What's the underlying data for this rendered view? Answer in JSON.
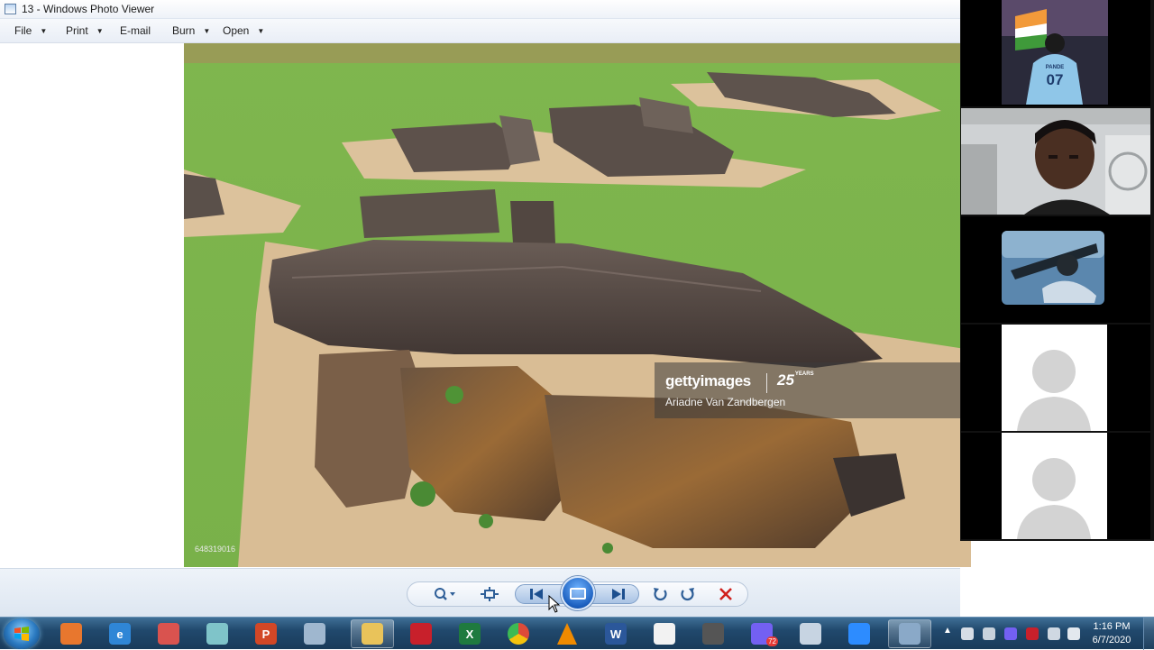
{
  "window": {
    "title": "13 - Windows Photo Viewer",
    "icon": "photo-viewer-icon"
  },
  "menu": [
    {
      "label": "File",
      "has_dropdown": true
    },
    {
      "label": "Print",
      "has_dropdown": true
    },
    {
      "label": "E-mail",
      "has_dropdown": false
    },
    {
      "label": "Burn",
      "has_dropdown": true
    },
    {
      "label": "Open",
      "has_dropdown": true
    }
  ],
  "photo": {
    "watermark_brand": "gettyimages",
    "watermark_years": "25",
    "watermark_years_suffix": "YEARS",
    "watermark_credit": "Ariadne Van Zandbergen",
    "photo_id": "648319016"
  },
  "controls": [
    {
      "name": "zoom-icon",
      "label": "Change display size"
    },
    {
      "name": "actual-size-icon",
      "label": "Actual size"
    },
    {
      "name": "previous-icon",
      "label": "Previous"
    },
    {
      "name": "slideshow-icon",
      "label": "Play slide show"
    },
    {
      "name": "next-icon",
      "label": "Next"
    },
    {
      "name": "rotate-ccw-icon",
      "label": "Rotate counterclockwise"
    },
    {
      "name": "rotate-cw-icon",
      "label": "Rotate clockwise"
    },
    {
      "name": "delete-icon",
      "label": "Delete"
    }
  ],
  "video_panel": {
    "tiles": [
      {
        "kind": "image",
        "jersey_name": "PANDE",
        "jersey_number": "07"
      },
      {
        "kind": "camera"
      },
      {
        "kind": "image"
      },
      {
        "kind": "avatar"
      },
      {
        "kind": "avatar"
      }
    ]
  },
  "taskbar": {
    "apps": [
      {
        "name": "windows-media-player-icon",
        "color": "#e8772e",
        "glyph": ""
      },
      {
        "name": "internet-explorer-icon",
        "color": "#2f86d6",
        "glyph": "e"
      },
      {
        "name": "snipping-tool-icon",
        "color": "#d9534f",
        "glyph": ""
      },
      {
        "name": "notepad-icon",
        "color": "#7fc4c9",
        "glyph": ""
      },
      {
        "name": "powerpoint-icon",
        "color": "#d24726",
        "glyph": "P"
      },
      {
        "name": "calculator-icon",
        "color": "#9fb7cf",
        "glyph": ""
      },
      {
        "name": "file-explorer-icon",
        "color": "#e9c35a",
        "glyph": ""
      },
      {
        "name": "download-manager-icon",
        "color": "#c8202b",
        "glyph": ""
      },
      {
        "name": "excel-icon",
        "color": "#1f7a3f",
        "glyph": "X"
      },
      {
        "name": "chrome-icon",
        "color": "#dd4b39",
        "glyph": ""
      },
      {
        "name": "vlc-icon",
        "color": "#f08a00",
        "glyph": ""
      },
      {
        "name": "word-icon",
        "color": "#2b579a",
        "glyph": "W"
      },
      {
        "name": "sticky-notes-icon",
        "color": "#f2f2f2",
        "glyph": ""
      },
      {
        "name": "media-icon",
        "color": "#555555",
        "glyph": ""
      },
      {
        "name": "viber-icon",
        "color": "#7360f2",
        "glyph": ""
      },
      {
        "name": "paint-icon",
        "color": "#c7d4e2",
        "glyph": ""
      },
      {
        "name": "zoom-app-icon",
        "color": "#2d8cff",
        "glyph": ""
      },
      {
        "name": "photo-viewer-task-icon",
        "color": "#8aa9c8",
        "glyph": ""
      }
    ],
    "badge": "72",
    "time": "1:16 PM",
    "date": "6/7/2020"
  }
}
